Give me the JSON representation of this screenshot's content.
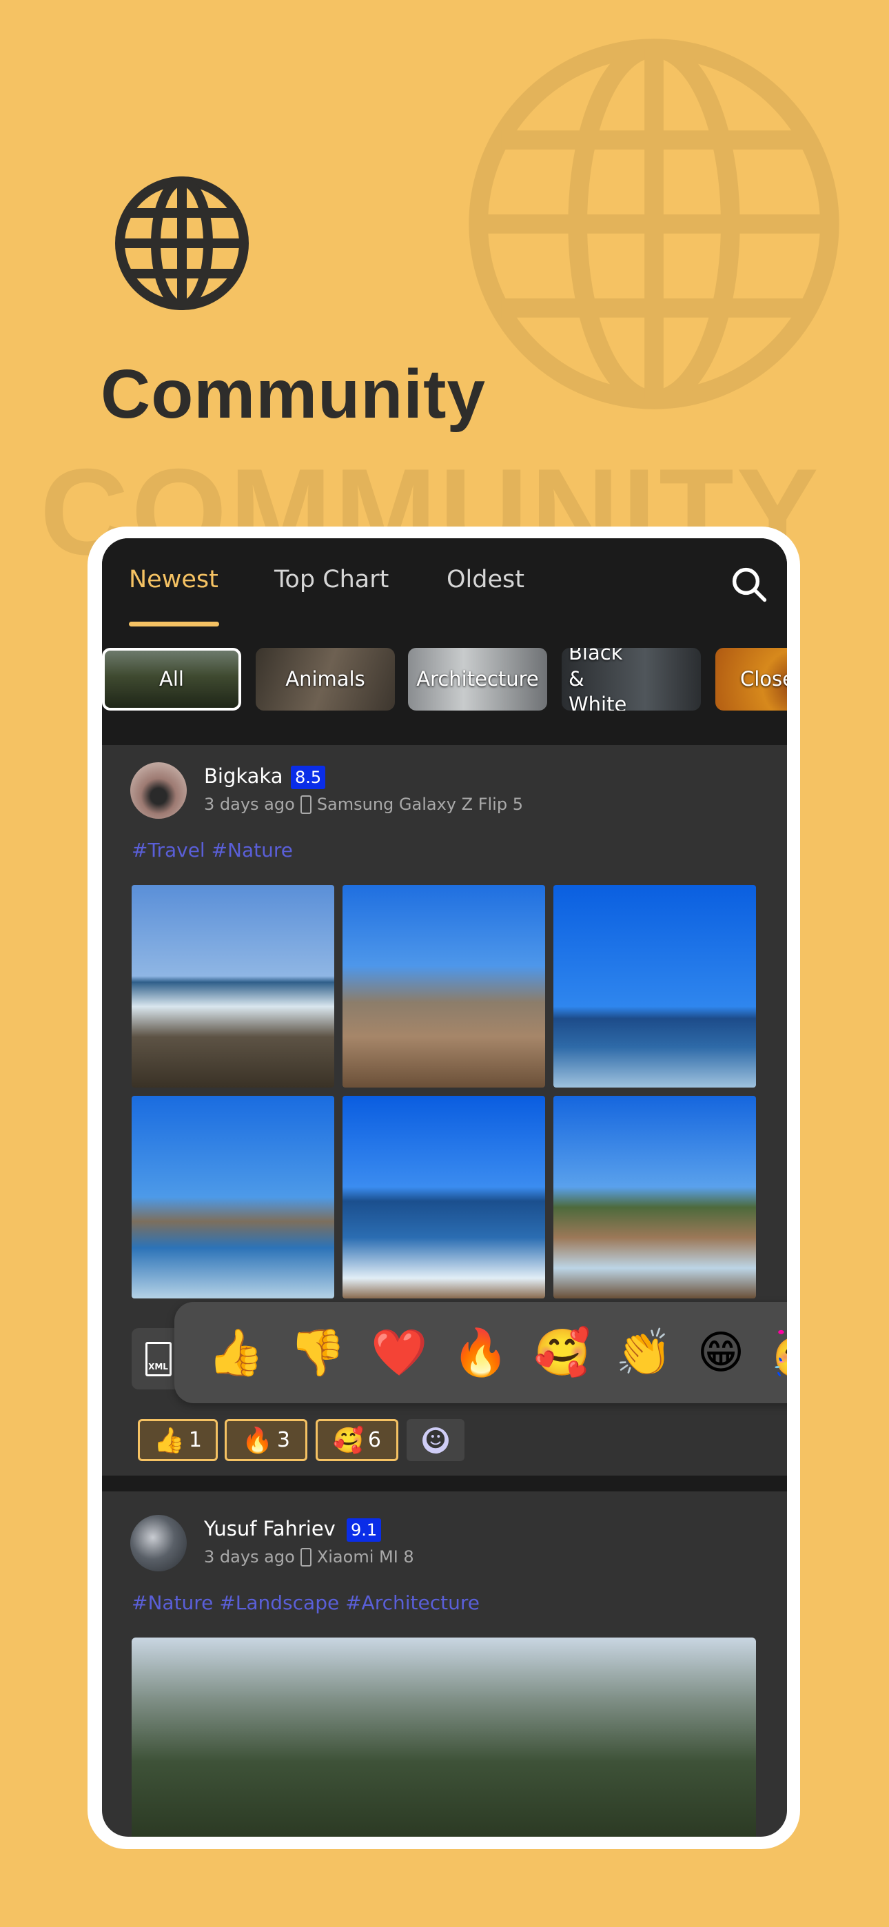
{
  "hero": {
    "title": "Community",
    "watermark": "COMMUNITY",
    "icon": "globe-icon"
  },
  "tabs": [
    {
      "label": "Newest",
      "active": true
    },
    {
      "label": "Top Chart"
    },
    {
      "label": "Oldest"
    }
  ],
  "categories": [
    {
      "label": "All",
      "selected": true
    },
    {
      "label": "Animals"
    },
    {
      "label": "Architecture"
    },
    {
      "label": "Black & White"
    },
    {
      "label": "Close"
    }
  ],
  "posts": [
    {
      "user": "Bigkaka",
      "score": "8.5",
      "time": "3 days ago",
      "device": "Samsung Galaxy Z Flip 5",
      "tags": "#Travel #Nature",
      "reactions": [
        {
          "emoji": "👍",
          "count": "1"
        },
        {
          "emoji": "🔥",
          "count": "3"
        },
        {
          "emoji": "🥰",
          "count": "6"
        }
      ]
    },
    {
      "user": "Yusuf Fahriev",
      "score": "9.1",
      "time": "3 days ago",
      "device": "Xiaomi MI 8",
      "tags": "#Nature #Landscape #Architecture"
    }
  ],
  "attachment": {
    "label": "XML"
  },
  "emoji_picker": [
    "👍",
    "👎",
    "❤️",
    "🔥",
    "🥰",
    "👏",
    "😁",
    "🥳"
  ],
  "add_reaction": "☻",
  "colors": {
    "background": "#f5c263",
    "accent": "#f5c263",
    "badge": "#0a2de8",
    "hashtag": "#5a5fd8"
  }
}
